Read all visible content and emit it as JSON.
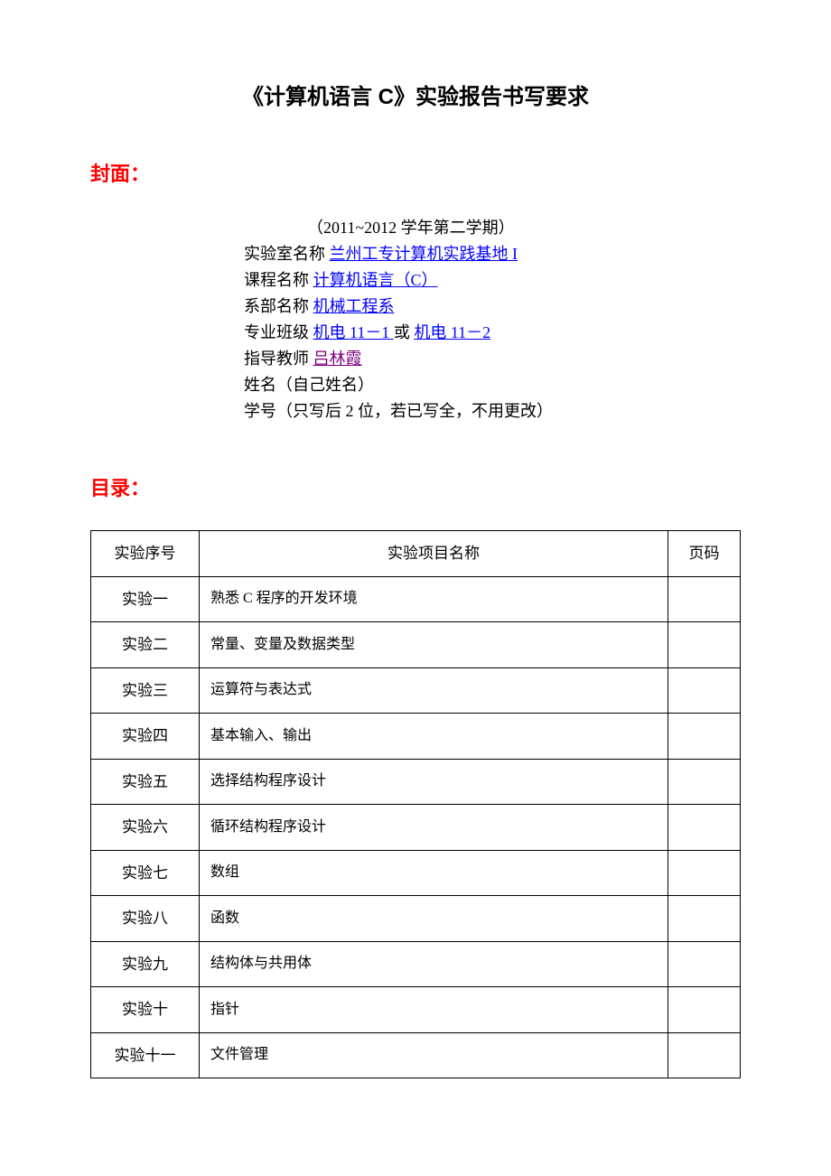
{
  "title": "《计算机语言 C》实验报告书写要求",
  "cover": {
    "section_label": "封面：",
    "semester": "（2011~2012 学年第二学期）",
    "lab_label": "实验室名称 ",
    "lab_value": "兰州工专计算机实践基地 I",
    "course_label": "课程名称 ",
    "course_value": "计算机语言（C）",
    "dept_label": "系部名称 ",
    "dept_value": "机械工程系",
    "class_label": "专业班级 ",
    "class_value1": "机电 11－1 ",
    "class_or": " 或 ",
    "class_value2": "机电 11－2",
    "teacher_label": "指导教师 ",
    "teacher_value": "吕林霞",
    "name_line": "姓名（自己姓名）",
    "id_line": "学号（只写后 2 位，若已写全，不用更改）"
  },
  "toc": {
    "section_label": "目录：",
    "headers": {
      "seq": "实验序号",
      "name": "实验项目名称",
      "page": "页码"
    },
    "rows": [
      {
        "seq": "实验一",
        "name": "熟悉 C 程序的开发环境",
        "page": ""
      },
      {
        "seq": "实验二",
        "name": "常量、变量及数据类型",
        "page": ""
      },
      {
        "seq": "实验三",
        "name": "运算符与表达式",
        "page": ""
      },
      {
        "seq": "实验四",
        "name": "基本输入、输出",
        "page": ""
      },
      {
        "seq": "实验五",
        "name": "选择结构程序设计",
        "page": ""
      },
      {
        "seq": "实验六",
        "name": "循环结构程序设计",
        "page": ""
      },
      {
        "seq": "实验七",
        "name": "数组",
        "page": ""
      },
      {
        "seq": "实验八",
        "name": "函数",
        "page": ""
      },
      {
        "seq": "实验九",
        "name": "结构体与共用体",
        "page": ""
      },
      {
        "seq": "实验十",
        "name": "指针",
        "page": ""
      },
      {
        "seq": "实验十一",
        "name": "文件管理",
        "page": ""
      }
    ]
  }
}
